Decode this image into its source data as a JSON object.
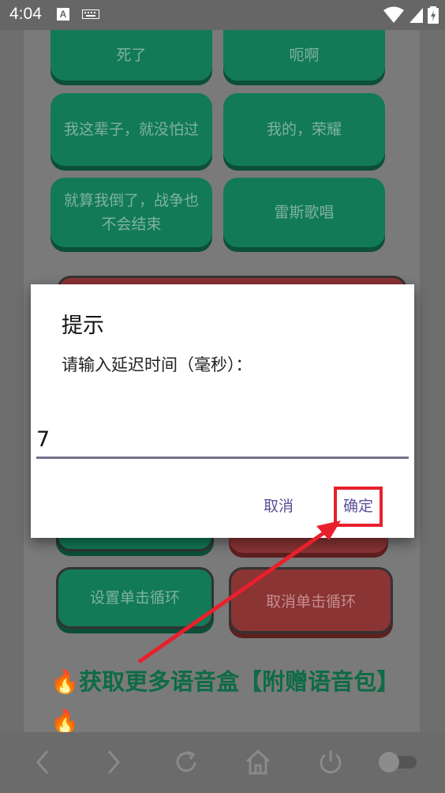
{
  "status_bar": {
    "time": "4:04",
    "a_badge": "A"
  },
  "background": {
    "buttons": [
      "死了",
      "呃啊",
      "我这辈子，就没怕过",
      "我的，荣耀",
      "就算我倒了，战争也不会结束",
      "雷斯歌唱"
    ],
    "set_loop": "设置单击循环",
    "cancel_loop": "取消单击循环",
    "promo": "🔥获取更多语音盒【附赠语音包】🔥"
  },
  "dialog": {
    "title": "提示",
    "message": "请输入延迟时间（毫秒）：",
    "input_value": "7",
    "cancel": "取消",
    "confirm": "确定"
  },
  "colors": {
    "accent": "#5d4e99",
    "annotation": "#e8202c",
    "green_button": "#127a56",
    "red_button": "#8a3434"
  }
}
